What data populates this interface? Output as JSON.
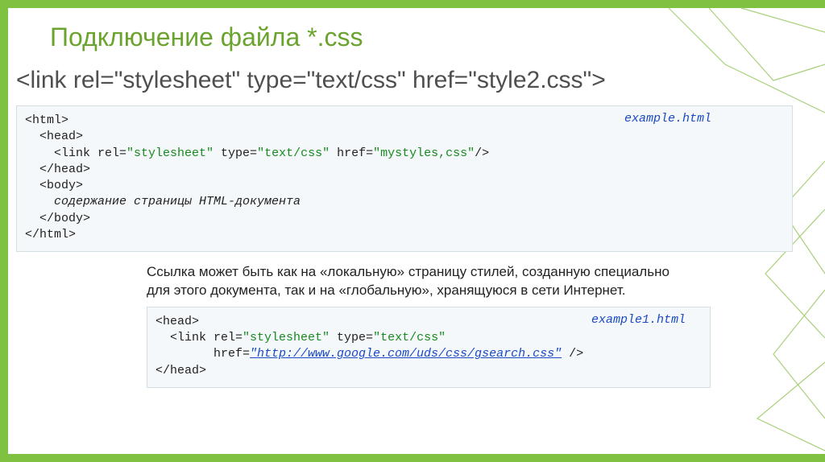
{
  "title": "Подключение файла *.css",
  "subtitle": "<link rel=\"stylesheet\" type=\"text/css\" href=\"style2.css\">",
  "example1": {
    "label": "example.html",
    "l1": "<html>",
    "l2": "<head>",
    "l3a": "<link rel=",
    "l3b": "\"stylesheet\"",
    "l3c": " type=",
    "l3d": "\"text/css\"",
    "l3e": " href=",
    "l3f": "\"mystyles,css\"",
    "l3g": "/>",
    "l4": "</head>",
    "l5": "<body>",
    "l6": "содержание страницы HTML-документа",
    "l7": "</body>",
    "l8": "</html>"
  },
  "paragraph": "Ссылка может быть как на «локальную» страницу стилей, созданную специально для этого документа, так и на «глобальную», хранящуюся в сети Интернет.",
  "example2": {
    "label": "example1.html",
    "l1": "<head>",
    "l2a": "<link rel=",
    "l2b": "\"stylesheet\"",
    "l2c": " type=",
    "l2d": "\"text/css\"",
    "l3a": "href=",
    "l3b": "\"http://www.google.com/uds/css/gsearch.css\"",
    "l3c": " />",
    "l4": "</head>"
  }
}
